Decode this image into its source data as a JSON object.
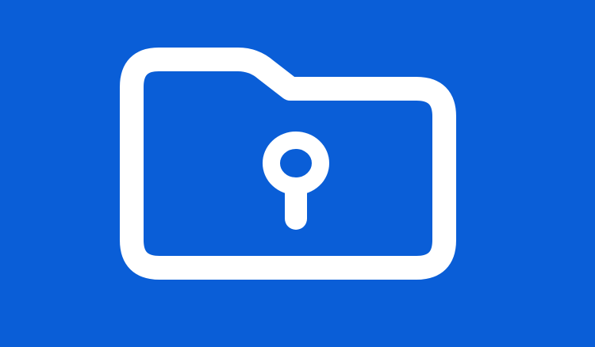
{
  "app_icon": {
    "icon_name": "locked-folder-icon",
    "background_color": "#0A5ED7",
    "foreground_color": "#FFFFFF"
  }
}
